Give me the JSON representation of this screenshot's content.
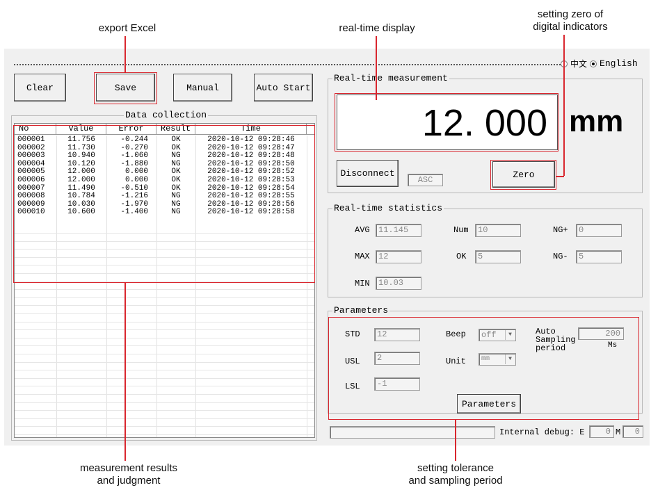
{
  "callouts": {
    "export_excel": "export Excel",
    "realtime_display": "real-time display",
    "zero_line1": "setting zero of",
    "zero_line2": "digital indicators",
    "results_line1": "measurement results",
    "results_line2": "and judgment",
    "tolerance_line1": "setting tolerance",
    "tolerance_line2": "and sampling period"
  },
  "language": {
    "chinese": "中文",
    "english": "English",
    "selected": "English"
  },
  "toolbar": {
    "clear": "Clear",
    "save": "Save",
    "manual": "Manual",
    "auto_start": "Auto Start"
  },
  "data_collection": {
    "title": "Data collection",
    "columns": [
      "No",
      "Value",
      "Error",
      "Result",
      "Time"
    ],
    "rows": [
      [
        "000001",
        "11.756",
        "-0.244",
        "OK",
        "2020-10-12 09:28:46"
      ],
      [
        "000002",
        "11.730",
        "-0.270",
        "OK",
        "2020-10-12 09:28:47"
      ],
      [
        "000003",
        "10.940",
        "-1.060",
        "NG",
        "2020-10-12 09:28:48"
      ],
      [
        "000004",
        "10.120",
        "-1.880",
        "NG",
        "2020-10-12 09:28:50"
      ],
      [
        "000005",
        "12.000",
        "0.000",
        "OK",
        "2020-10-12 09:28:52"
      ],
      [
        "000006",
        "12.000",
        "0.000",
        "OK",
        "2020-10-12 09:28:53"
      ],
      [
        "000007",
        "11.490",
        "-0.510",
        "OK",
        "2020-10-12 09:28:54"
      ],
      [
        "000008",
        "10.784",
        "-1.216",
        "NG",
        "2020-10-12 09:28:55"
      ],
      [
        "000009",
        "10.030",
        "-1.970",
        "NG",
        "2020-10-12 09:28:56"
      ],
      [
        "000010",
        "10.600",
        "-1.400",
        "NG",
        "2020-10-12 09:28:58"
      ]
    ]
  },
  "realtime": {
    "title": "Real-time measurement",
    "value": "12. 000",
    "unit": "mm",
    "disconnect": "Disconnect",
    "asc": "ASC",
    "zero": "Zero"
  },
  "statistics": {
    "title": "Real-time statistics",
    "avg_label": "AVG",
    "avg": "11.145",
    "num_label": "Num",
    "num": "10",
    "ngplus_label": "NG+",
    "ngplus": "0",
    "max_label": "MAX",
    "max": "12",
    "ok_label": "OK",
    "ok": "5",
    "ngminus_label": "NG-",
    "ngminus": "5",
    "min_label": "MIN",
    "min": "10.03"
  },
  "parameters": {
    "title": "Parameters",
    "std_label": "STD",
    "std": "12",
    "usl_label": "USL",
    "usl": "2",
    "lsl_label": "LSL",
    "lsl": "-1",
    "beep_label": "Beep",
    "beep": "off",
    "unit_label": "Unit",
    "unit": "mm",
    "auto_line1": "Auto",
    "auto_line2": "Sampling",
    "auto_line3": "period",
    "auto_value": "200",
    "auto_unit": "Ms",
    "button": "Parameters"
  },
  "status": {
    "debug_label": "Internal debug: E",
    "e_value": "0",
    "m_label": "M",
    "m_value": "0"
  }
}
